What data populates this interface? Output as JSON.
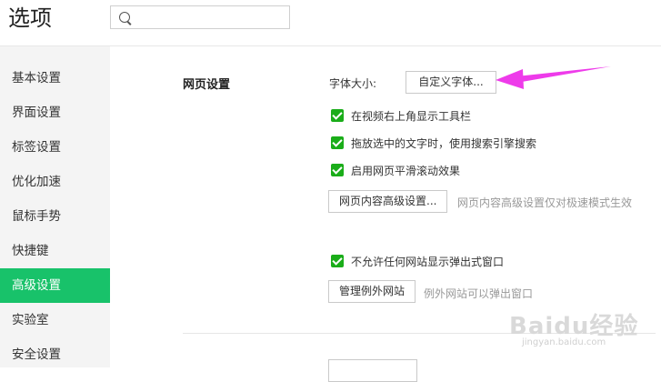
{
  "header": {
    "title": "选项",
    "search_placeholder": ""
  },
  "sidebar": {
    "items": [
      {
        "label": "基本设置",
        "active": false
      },
      {
        "label": "界面设置",
        "active": false
      },
      {
        "label": "标签设置",
        "active": false
      },
      {
        "label": "优化加速",
        "active": false
      },
      {
        "label": "鼠标手势",
        "active": false
      },
      {
        "label": "快捷键",
        "active": false
      },
      {
        "label": "高级设置",
        "active": true
      },
      {
        "label": "实验室",
        "active": false
      },
      {
        "label": "安全设置",
        "active": false
      }
    ]
  },
  "web_settings": {
    "section_title": "网页设置",
    "font_size_label": "字体大小:",
    "custom_font_button": "自定义字体...",
    "checkboxes": [
      {
        "label": "在视频右上角显示工具栏",
        "checked": true
      },
      {
        "label": "拖放选中的文字时，使用搜索引擎搜索",
        "checked": true
      },
      {
        "label": "启用网页平滑滚动效果",
        "checked": true
      }
    ],
    "advanced_content_button": "网页内容高级设置...",
    "advanced_content_hint": "网页内容高级设置仅对极速模式生效",
    "popup_checkbox": {
      "label": "不允许任何网站显示弹出式窗口",
      "checked": true
    },
    "manage_exceptions_button": "管理例外网站",
    "exceptions_hint": "例外网站可以弹出窗口"
  },
  "watermark": {
    "brand": "Baidu经验",
    "url": "jingyan.baidu.com"
  },
  "colors": {
    "active": "#18c26a",
    "checkbox": "#1aad19",
    "arrow": "#ee3bea"
  },
  "icons": {
    "search": "search-icon",
    "arrow": "magenta-arrow-annotation"
  }
}
